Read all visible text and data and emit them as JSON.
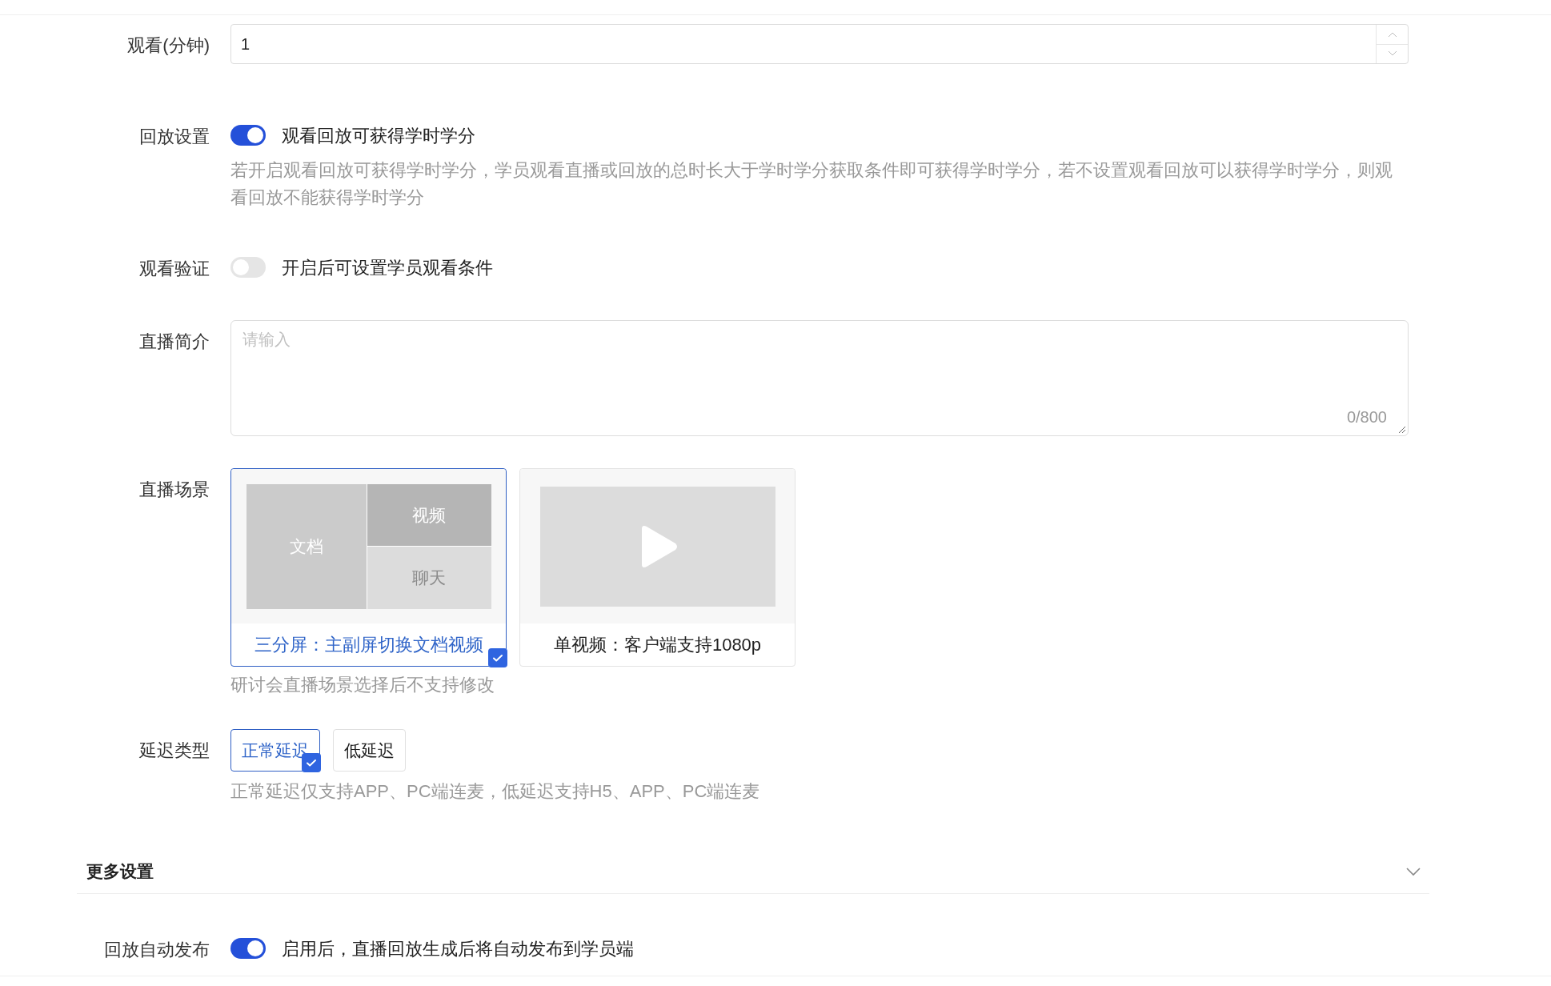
{
  "fields": [
    {
      "kind": "number",
      "label": "观看(分钟)",
      "value": "1"
    },
    {
      "kind": "toggle",
      "label": "回放设置",
      "on": true,
      "text": "观看回放可获得学时学分",
      "help": "若开启观看回放可获得学时学分，学员观看直播或回放的总时长大于学时学分获取条件即可获得学时学分，若不设置观看回放可以获得学时学分，则观看回放不能获得学时学分"
    },
    {
      "kind": "toggle",
      "label": "观看验证",
      "on": false,
      "text": "开启后可设置学员观看条件"
    },
    {
      "kind": "textarea",
      "label": "直播简介",
      "placeholder": "请输入",
      "counter": "0/800"
    },
    {
      "kind": "scenes",
      "label": "直播场景",
      "options": [
        {
          "kind": "split",
          "selected": true,
          "caption": "三分屏：主副屏切换文档视频",
          "panes": [
            "文档",
            "视频",
            "聊天"
          ]
        },
        {
          "kind": "video",
          "selected": false,
          "caption": "单视频：客户端支持1080p"
        }
      ],
      "help": "研讨会直播场景选择后不支持修改"
    },
    {
      "kind": "options",
      "label": "延迟类型",
      "options": [
        {
          "label": "正常延迟",
          "selected": true
        },
        {
          "label": "低延迟",
          "selected": false
        }
      ],
      "help": "正常延迟仅支持APP、PC端连麦，低延迟支持H5、APP、PC端连麦"
    }
  ],
  "more_settings": {
    "title": "更多设置",
    "fields": [
      {
        "kind": "toggle",
        "label": "回放自动发布",
        "on": true,
        "text": "启用后，直播回放生成后将自动发布到学员端"
      }
    ]
  }
}
